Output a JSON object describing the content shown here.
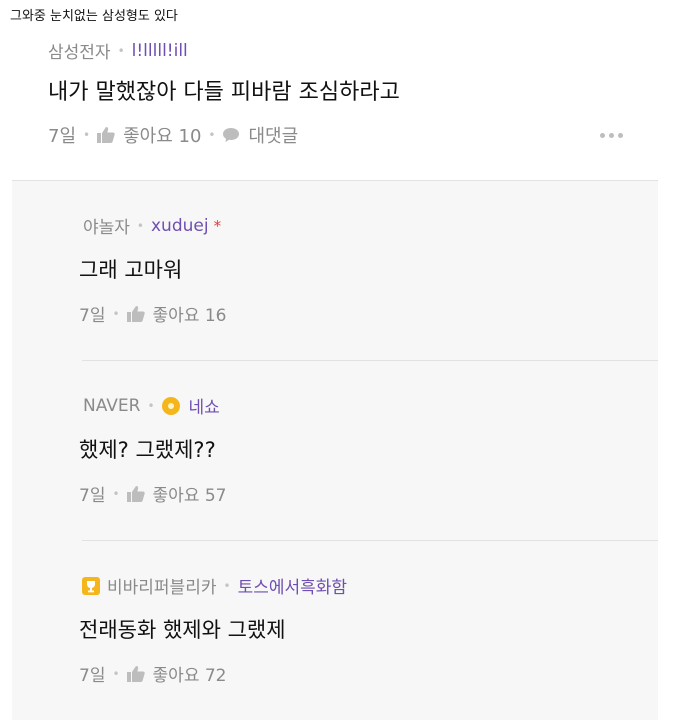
{
  "caption": "그와중 눈치없는 삼성형도 있다",
  "main_comment": {
    "source": "삼성전자",
    "nickname": "l!lllll!ill",
    "text": "내가 말했잖아 다들 피바람 조심하라고",
    "time": "7일",
    "likes": "좋아요 10",
    "reply_label": "대댓글"
  },
  "replies": [
    {
      "source": "야놀자",
      "nickname": "xuduej",
      "badge": "",
      "text": "그래 고마워",
      "time": "7일",
      "likes": "좋아요 16"
    },
    {
      "source": "NAVER",
      "nickname": "네쇼",
      "badge": "flower-icon",
      "text": "했제? 그랬제??",
      "time": "7일",
      "likes": "좋아요 57"
    },
    {
      "source": "비바리퍼블리카",
      "nickname": "토스에서흑화함",
      "badge": "trophy-icon",
      "text": "전래동화 했제와 그랬제",
      "time": "7일",
      "likes": "좋아요 72"
    }
  ],
  "colors": {
    "nickname": "#6f4fb1",
    "meta": "#8a8a8a",
    "reply_bg": "#f7f7f7",
    "badge": "#f5b61c"
  }
}
